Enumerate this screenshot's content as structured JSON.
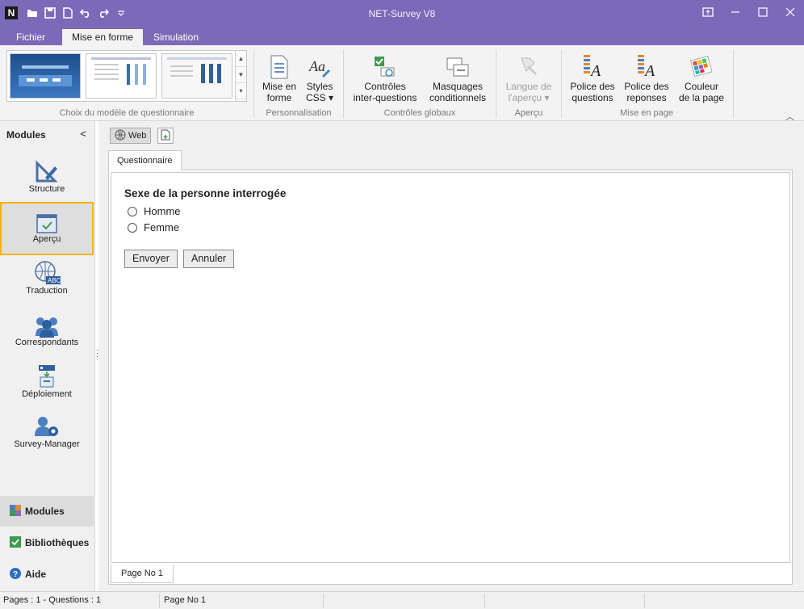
{
  "window": {
    "title": "NET-Survey V8",
    "app_logo": "N"
  },
  "quick_access": [
    "folder-open-icon",
    "save-icon",
    "new-file-icon",
    "undo-icon",
    "redo-icon",
    "customize-icon"
  ],
  "menu_tabs": [
    {
      "label": "Fichier"
    },
    {
      "label": "Mise en forme",
      "active": true
    },
    {
      "label": "Simulation"
    }
  ],
  "ribbon": {
    "group_labels": {
      "gallery": "Choix du modèle de questionnaire",
      "personnalisation": "Personnalisation",
      "controles": "Contrôles globaux",
      "apercu": "Aperçu",
      "mise_en_page": "Mise en page"
    },
    "buttons": {
      "mise_en_forme": "Mise en\nforme",
      "styles_css": "Styles\nCSS ▾",
      "controles_inter": "Contrôles\ninter-questions",
      "masquages": "Masquages\nconditionnels",
      "langue": "Langue de\nl'aperçu ▾",
      "police_questions": "Police des\nquestions",
      "police_reponses": "Police des\nreponses",
      "couleur_page": "Couleur\nde la page"
    }
  },
  "sidebar": {
    "header": "Modules",
    "modules": [
      {
        "label": "Structure"
      },
      {
        "label": "Aperçu",
        "active": true
      },
      {
        "label": "Traduction"
      },
      {
        "label": "Correspondants"
      },
      {
        "label": "Déploiement"
      },
      {
        "label": "Survey-Manager"
      }
    ],
    "footer": [
      {
        "label": "Modules",
        "active": true
      },
      {
        "label": "Bibliothèques"
      },
      {
        "label": "Aide"
      }
    ]
  },
  "toolbar": {
    "web_label": "Web"
  },
  "content": {
    "tab": "Questionnaire",
    "question": "Sexe de la personne interrogée",
    "options": [
      "Homme",
      "Femme"
    ],
    "submit_label": "Envoyer",
    "cancel_label": "Annuler",
    "page_tab": "Page No 1"
  },
  "status": {
    "counts": "Pages : 1 - Questions : 1",
    "page": "Page No 1"
  },
  "colors": {
    "accent": "#7b6ab8",
    "highlight": "#f4b400"
  }
}
